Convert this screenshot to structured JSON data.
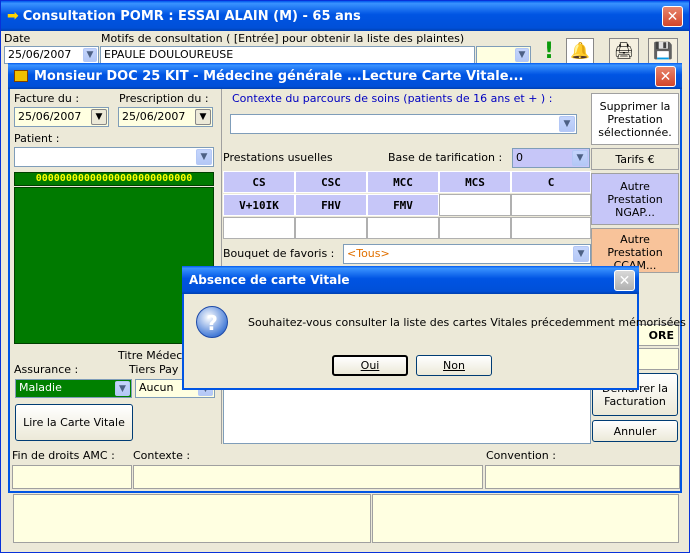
{
  "main_window": {
    "title": "Consultation POMR : ESSAI ALAIN (M) -  65 ans",
    "date_label": "Date",
    "date_value": "25/06/2007",
    "motifs_label": "Motifs de consultation ( [Entrée]  pour obtenir la liste des plaintes)",
    "motif_value": "EPAULE DOULOUREUSE"
  },
  "vitale_window": {
    "title": "Monsieur DOC 25 KIT - Médecine générale ...Lecture Carte Vitale...",
    "facture_label": "Facture du :",
    "facture_value": "25/06/2007",
    "prescription_label": "Prescription du :",
    "prescription_value": "25/06/2007",
    "patient_label": "Patient :",
    "card_number": "00000000000000000000000000",
    "titre_label": "Titre Médec",
    "assurance_label": "Assurance :",
    "assurance_value": "Maladie",
    "tiers_label": "Tiers Pay",
    "tiers_value": "Aucun",
    "lire_btn": "Lire la Carte Vitale",
    "contexte_label": "Contexte du parcours de soins (patients de 16 ans et + ) :",
    "prestations_label": "Prestations usuelles",
    "base_label": "Base de tarification :",
    "base_value": "0",
    "prestations": [
      "CS",
      "CSC",
      "MCC",
      "MCS",
      "C",
      "V+10IK",
      "FHV",
      "FMV"
    ],
    "bouquet_label": "Bouquet de favoris :",
    "bouquet_value": "<Tous>",
    "supprimer_btn": "Supprimer la Prestation sélectionnée.",
    "tarifs_btn": "Tarifs €",
    "ngap_btn": "Autre Prestation NGAP...",
    "ccam_btn": "Autre Prestation CCAM...",
    "partial_ore": "ORE",
    "partial_e": "E",
    "demarrer_btn": "Démarrer la Facturation",
    "annuler_btn": "Annuler",
    "fin_droits_label": "Fin de droits AMC :",
    "contexte2_label": "Contexte :",
    "convention_label": "Convention :"
  },
  "dialog": {
    "title": "Absence de carte Vitale",
    "message": "Souhaitez-vous consulter la liste des cartes Vitales précedemment mémorisées ?",
    "oui": "Oui",
    "non": "Non"
  },
  "colors": {
    "title_blue": "#0054e3",
    "card_green": "#007a00",
    "ngap_blue": "#c6c6f8",
    "ccam_orange": "#f8c39a",
    "maladie_green": "#008000"
  }
}
